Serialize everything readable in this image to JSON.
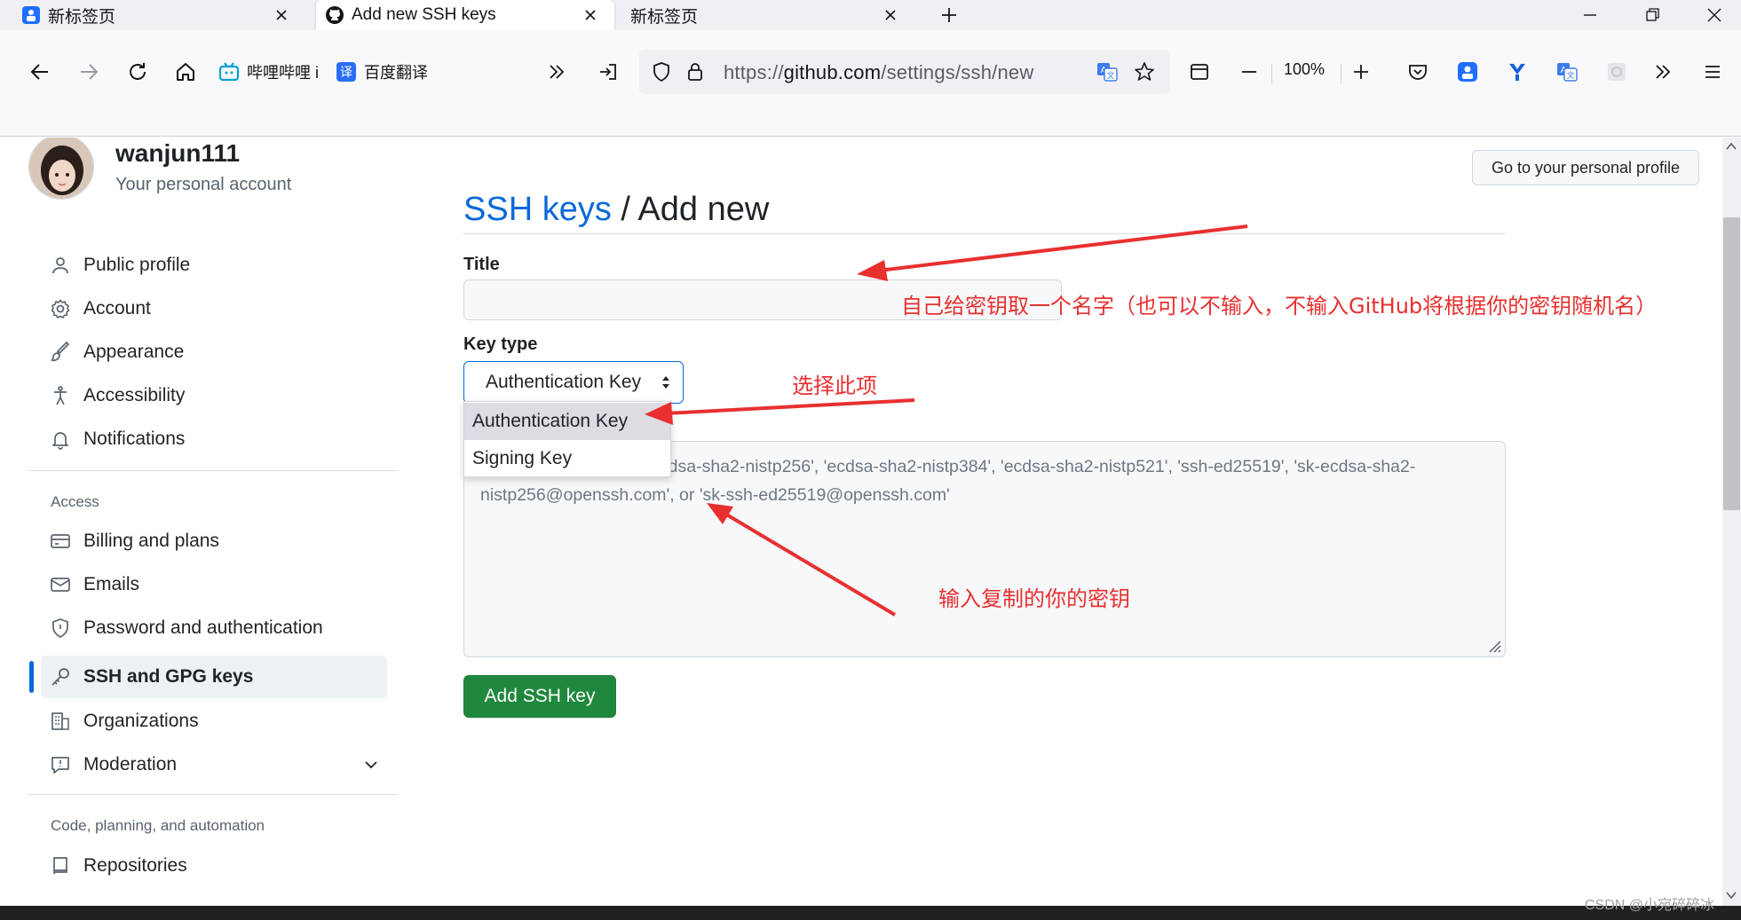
{
  "browser": {
    "tabs": [
      {
        "label": "新标签页"
      },
      {
        "label": "Add new SSH keys"
      },
      {
        "label": "新标签页"
      }
    ],
    "bookmarks": [
      {
        "label": "哔哩哔哩 i"
      },
      {
        "label": "百度翻译"
      }
    ],
    "url": {
      "prefix": "https://",
      "host": "github.com",
      "path": "/settings/ssh/new"
    },
    "zoom": "100%"
  },
  "account": {
    "username": "wanjun111",
    "subtitle": "Your personal account",
    "profile_button": "Go to your personal profile"
  },
  "sidebar": {
    "group1": [
      {
        "label": "Public profile",
        "icon": "person-icon"
      },
      {
        "label": "Account",
        "icon": "gear-icon"
      },
      {
        "label": "Appearance",
        "icon": "paintbrush-icon"
      },
      {
        "label": "Accessibility",
        "icon": "accessibility-icon"
      },
      {
        "label": "Notifications",
        "icon": "bell-icon"
      }
    ],
    "heading_access": "Access",
    "group2": [
      {
        "label": "Billing and plans",
        "icon": "credit-card-icon"
      },
      {
        "label": "Emails",
        "icon": "mail-icon"
      },
      {
        "label": "Password and authentication",
        "icon": "shield-icon"
      },
      {
        "label": "SSH and GPG keys",
        "icon": "key-icon",
        "active": true
      },
      {
        "label": "Organizations",
        "icon": "organization-icon"
      },
      {
        "label": "Moderation",
        "icon": "report-icon"
      }
    ],
    "heading_code": "Code, planning, and automation",
    "group3": [
      {
        "label": "Repositories",
        "icon": "repo-icon"
      }
    ]
  },
  "main": {
    "heading_link": "SSH keys",
    "heading_rest": " / Add new",
    "title_label": "Title",
    "title_value": "",
    "keytype_label": "Key type",
    "keytype_selected": "Authentication Key",
    "keytype_options": [
      "Authentication Key",
      "Signing Key"
    ],
    "key_placeholder": "Begins with 'ssh-rsa', 'ecdsa-sha2-nistp256', 'ecdsa-sha2-nistp384', 'ecdsa-sha2-nistp521', 'ssh-ed25519', 'sk-ecdsa-sha2-nistp256@openssh.com', or 'sk-ssh-ed25519@openssh.com'",
    "add_button": "Add SSH key"
  },
  "annotations": {
    "title_note": "自己给密钥取一个名字（也可以不输入，不输入GitHub将根据你的密钥随机名）",
    "keytype_note": "选择此项",
    "key_note": "输入复制的你的密钥"
  },
  "colors": {
    "accent": "#0969da",
    "annotation": "#e8302f",
    "primary_button": "#1f883d"
  },
  "watermark": "CSDN @小宛碎碎冰"
}
